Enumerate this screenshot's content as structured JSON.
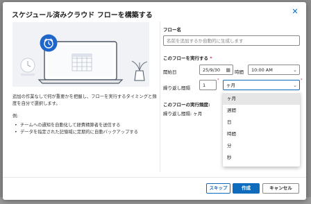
{
  "dialog": {
    "title": "スケジュール済みクラウド フローを構築する",
    "close_icon": "close-icon"
  },
  "illustration": {
    "icon": "alarm-clock-icon"
  },
  "description": {
    "text": "追加の作業なしで何が重要かを把握し、フローを実行するタイミングと頻度を自分で選択します。",
    "examples_heading": "例:",
    "examples": [
      "チームへの通知を自動化して経費精算者を送信する",
      "データを指定された記憶域に定期的に自動バックアップする"
    ]
  },
  "form": {
    "flow_name_label": "フロー名",
    "flow_name_placeholder": "名前を追加するか自動的に生成します",
    "run_section_label": "このフローを実行する",
    "required_mark": "*",
    "start_date_label": "開始日",
    "start_date_value": "25/9/30",
    "time_label": "時間",
    "time_value": "10:00 AM",
    "repeat_label": "繰り返し間隔",
    "repeat_value": "1",
    "unit_value": "ヶ月",
    "summary_label": "このフローの実行頻度:",
    "summary_text": "繰り返し間隔: ヶ月"
  },
  "unit_dropdown": {
    "options": [
      "ヶ月",
      "週間",
      "日",
      "時間",
      "分",
      "秒"
    ],
    "selected_index": 0
  },
  "footer": {
    "skip_label": "スキップ",
    "create_label": "作成",
    "cancel_label": "キャンセル"
  },
  "colors": {
    "accent": "#0f6cbd",
    "required": "#c4314b"
  }
}
